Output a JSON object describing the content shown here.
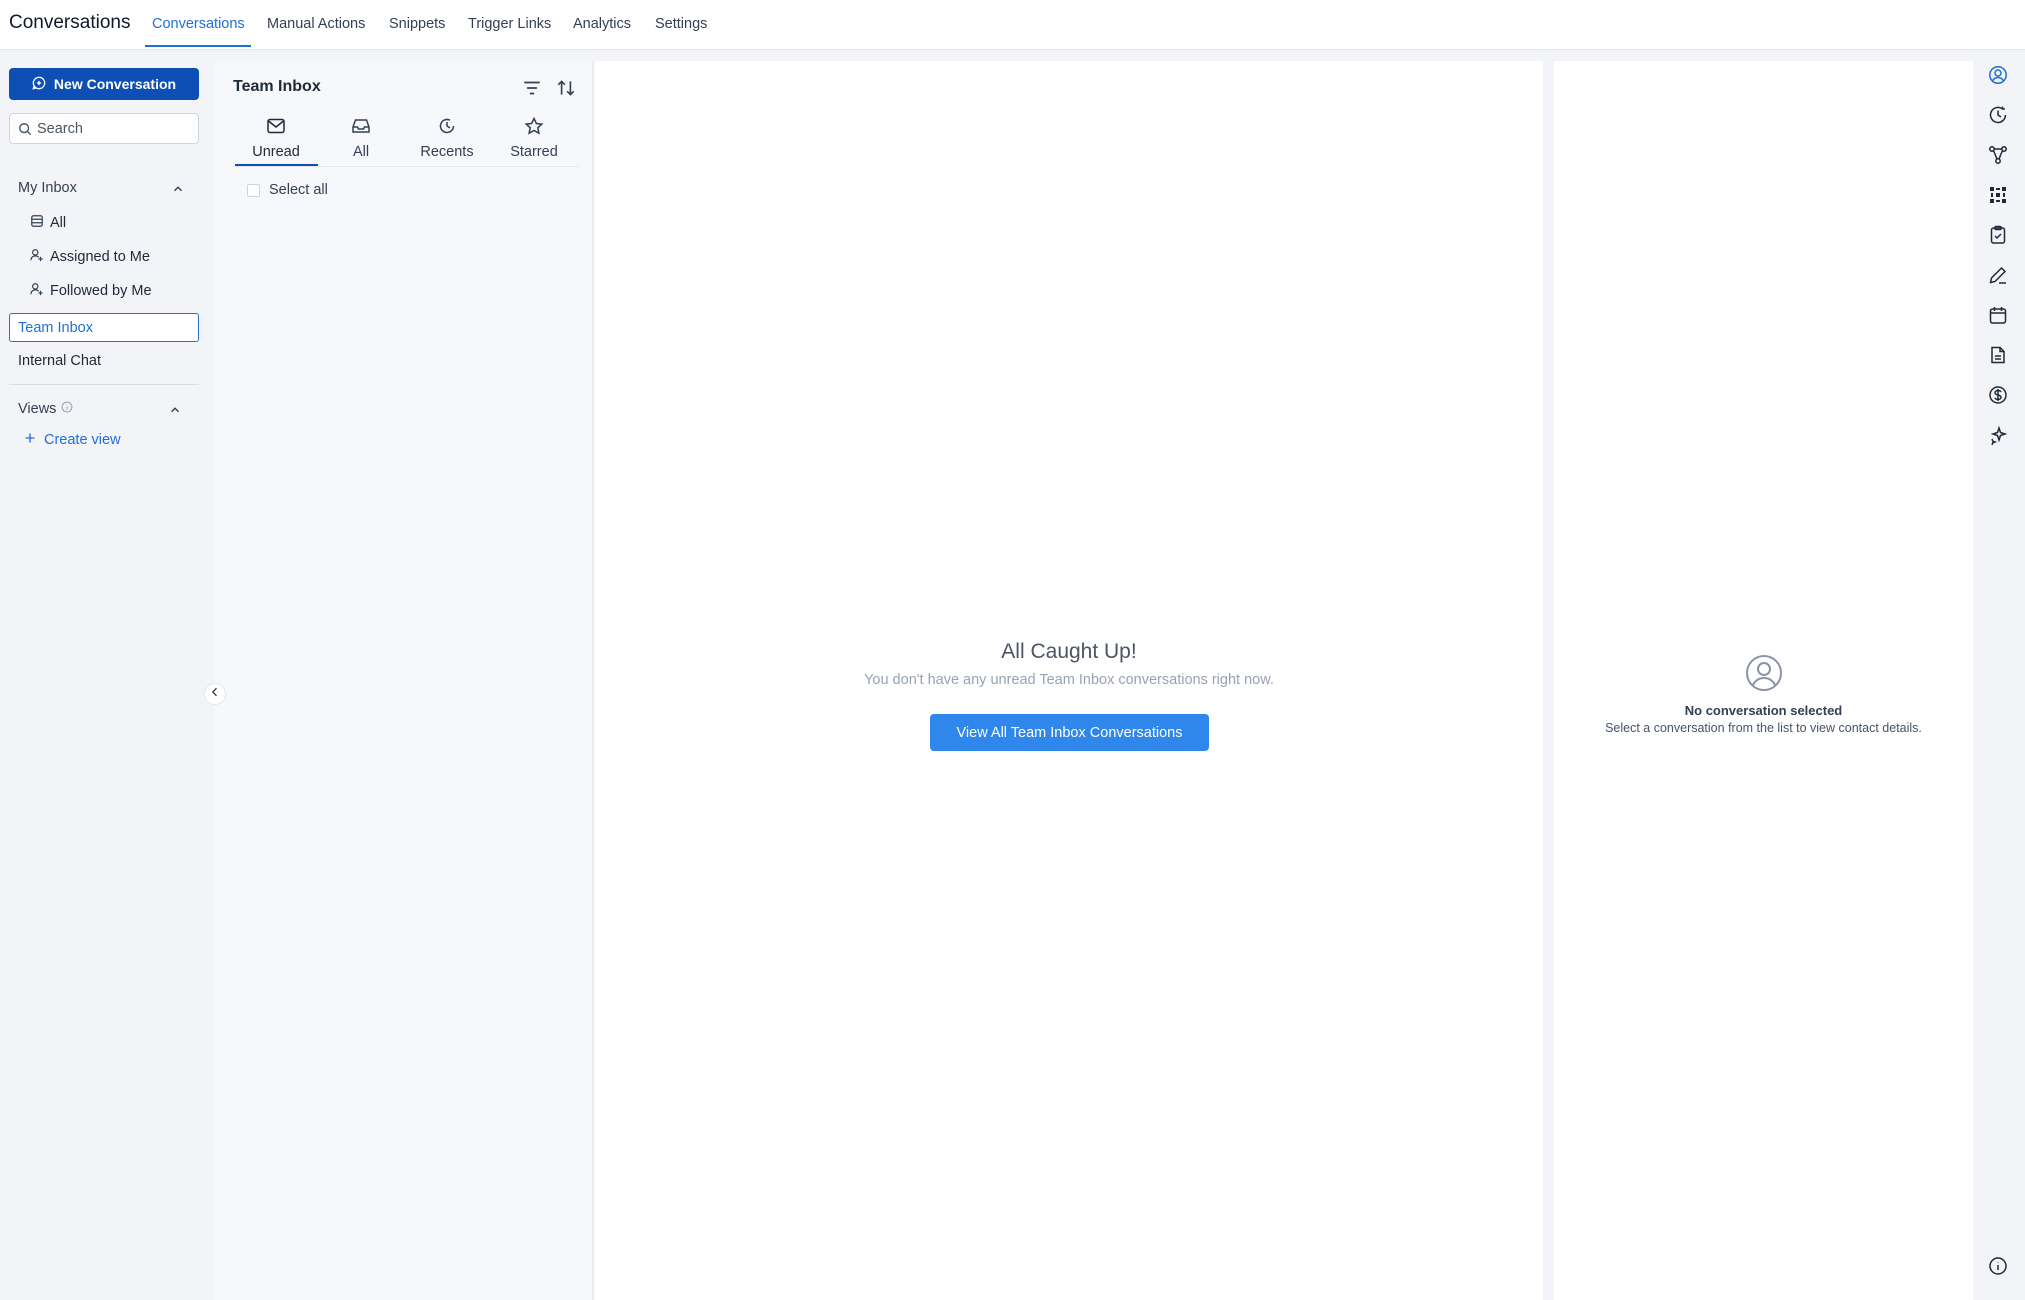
{
  "app": {
    "title": "Conversations"
  },
  "top_nav": {
    "tabs": [
      {
        "label": "Conversations"
      },
      {
        "label": "Manual Actions"
      },
      {
        "label": "Snippets"
      },
      {
        "label": "Trigger Links"
      },
      {
        "label": "Analytics"
      },
      {
        "label": "Settings"
      }
    ],
    "active": "Conversations"
  },
  "sidebar": {
    "new_conversation_label": "New Conversation",
    "search_placeholder": "Search",
    "my_inbox": {
      "label": "My Inbox",
      "items": [
        {
          "label": "All",
          "icon": "table-icon"
        },
        {
          "label": "Assigned to Me",
          "icon": "user-plus-icon"
        },
        {
          "label": "Followed by Me",
          "icon": "user-plus-icon"
        }
      ]
    },
    "team_inbox_label": "Team Inbox",
    "internal_chat_label": "Internal Chat",
    "views": {
      "label": "Views",
      "create_label": "Create view"
    }
  },
  "list_panel": {
    "title": "Team Inbox",
    "tabs": [
      {
        "label": "Unread",
        "icon": "mail-icon"
      },
      {
        "label": "All",
        "icon": "inbox-icon"
      },
      {
        "label": "Recents",
        "icon": "clock-icon"
      },
      {
        "label": "Starred",
        "icon": "star-icon"
      }
    ],
    "active_tab": "Unread",
    "select_all_label": "Select all"
  },
  "main": {
    "empty_title": "All Caught Up!",
    "empty_subtitle": "You don't have any unread Team Inbox conversations right now.",
    "view_all_button": "View All Team Inbox Conversations"
  },
  "contact": {
    "title": "No conversation selected",
    "subtitle": "Select a conversation from the list to view contact details."
  },
  "right_rail": {
    "icons": [
      "user-circle-icon",
      "history-icon",
      "workflow-icon",
      "integrations-icon",
      "tasks-icon",
      "notes-icon",
      "calendar-icon",
      "documents-icon",
      "payments-icon",
      "ai-sparkles-icon",
      "info-icon"
    ]
  },
  "colors": {
    "primary": "#0d4fb5",
    "accent": "#1e6fd9",
    "button": "#2f86eb"
  }
}
